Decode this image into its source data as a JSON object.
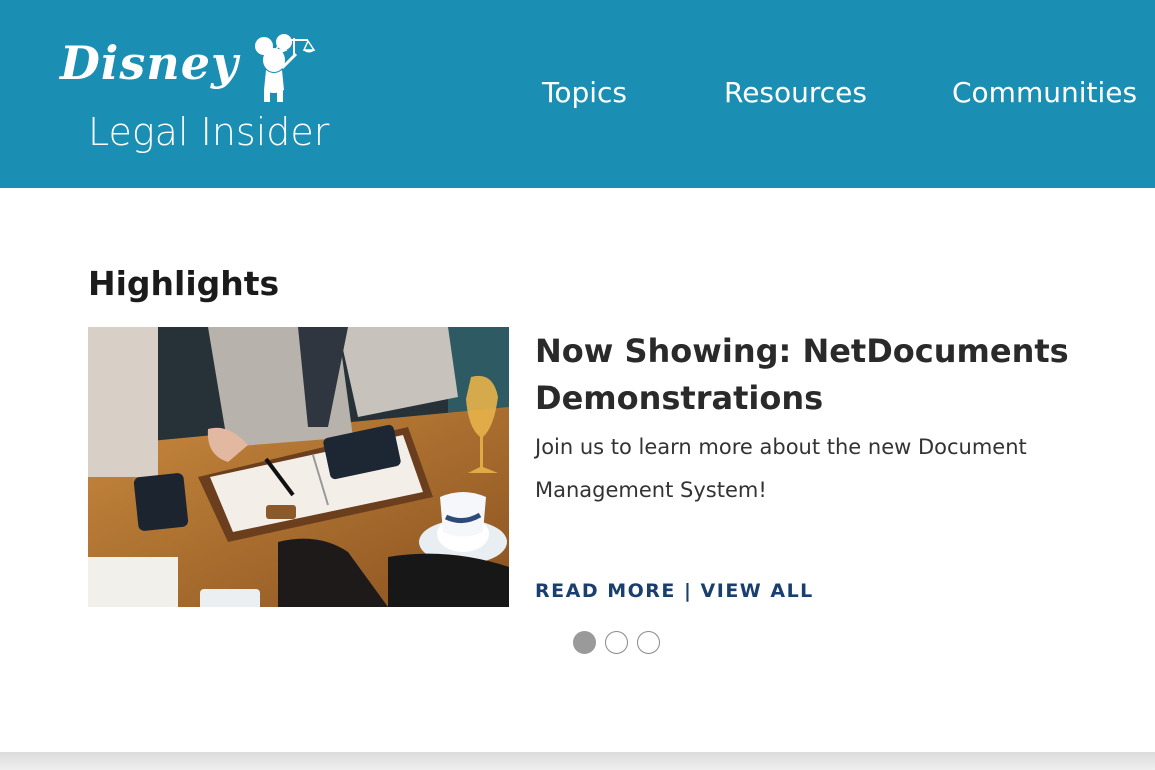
{
  "header": {
    "logo_word": "Disney",
    "logo_subtitle": "Legal Insider",
    "nav": [
      "Topics",
      "Resources",
      "Communities"
    ],
    "background_color": "#1a8fb3"
  },
  "highlights": {
    "section_title": "Highlights",
    "headline": "Now Showing: NetDocuments Demonstrations",
    "summary": "Join us to learn more about the new Document Management System!",
    "read_more_label": "READ MORE",
    "separator": " | ",
    "view_all_label": "VIEW ALL",
    "carousel": {
      "total": 3,
      "active_index": 0
    }
  },
  "icons": {
    "mickey": "mickey-scales-icon"
  }
}
